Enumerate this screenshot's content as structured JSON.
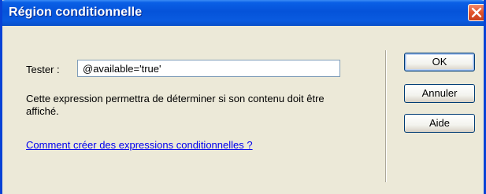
{
  "window": {
    "title": "Région conditionnelle",
    "close_icon": "close-icon",
    "accent_color": "#0553d9"
  },
  "form": {
    "tester_label": "Tester :",
    "tester_value": "@available='true'",
    "description": "Cette expression permettra de déterminer si son contenu doit être affiché.",
    "help_link": "Comment créer des expressions conditionnelles ?"
  },
  "buttons": {
    "ok_label": "OK",
    "cancel_label": "Annuler",
    "help_label": "Aide"
  }
}
